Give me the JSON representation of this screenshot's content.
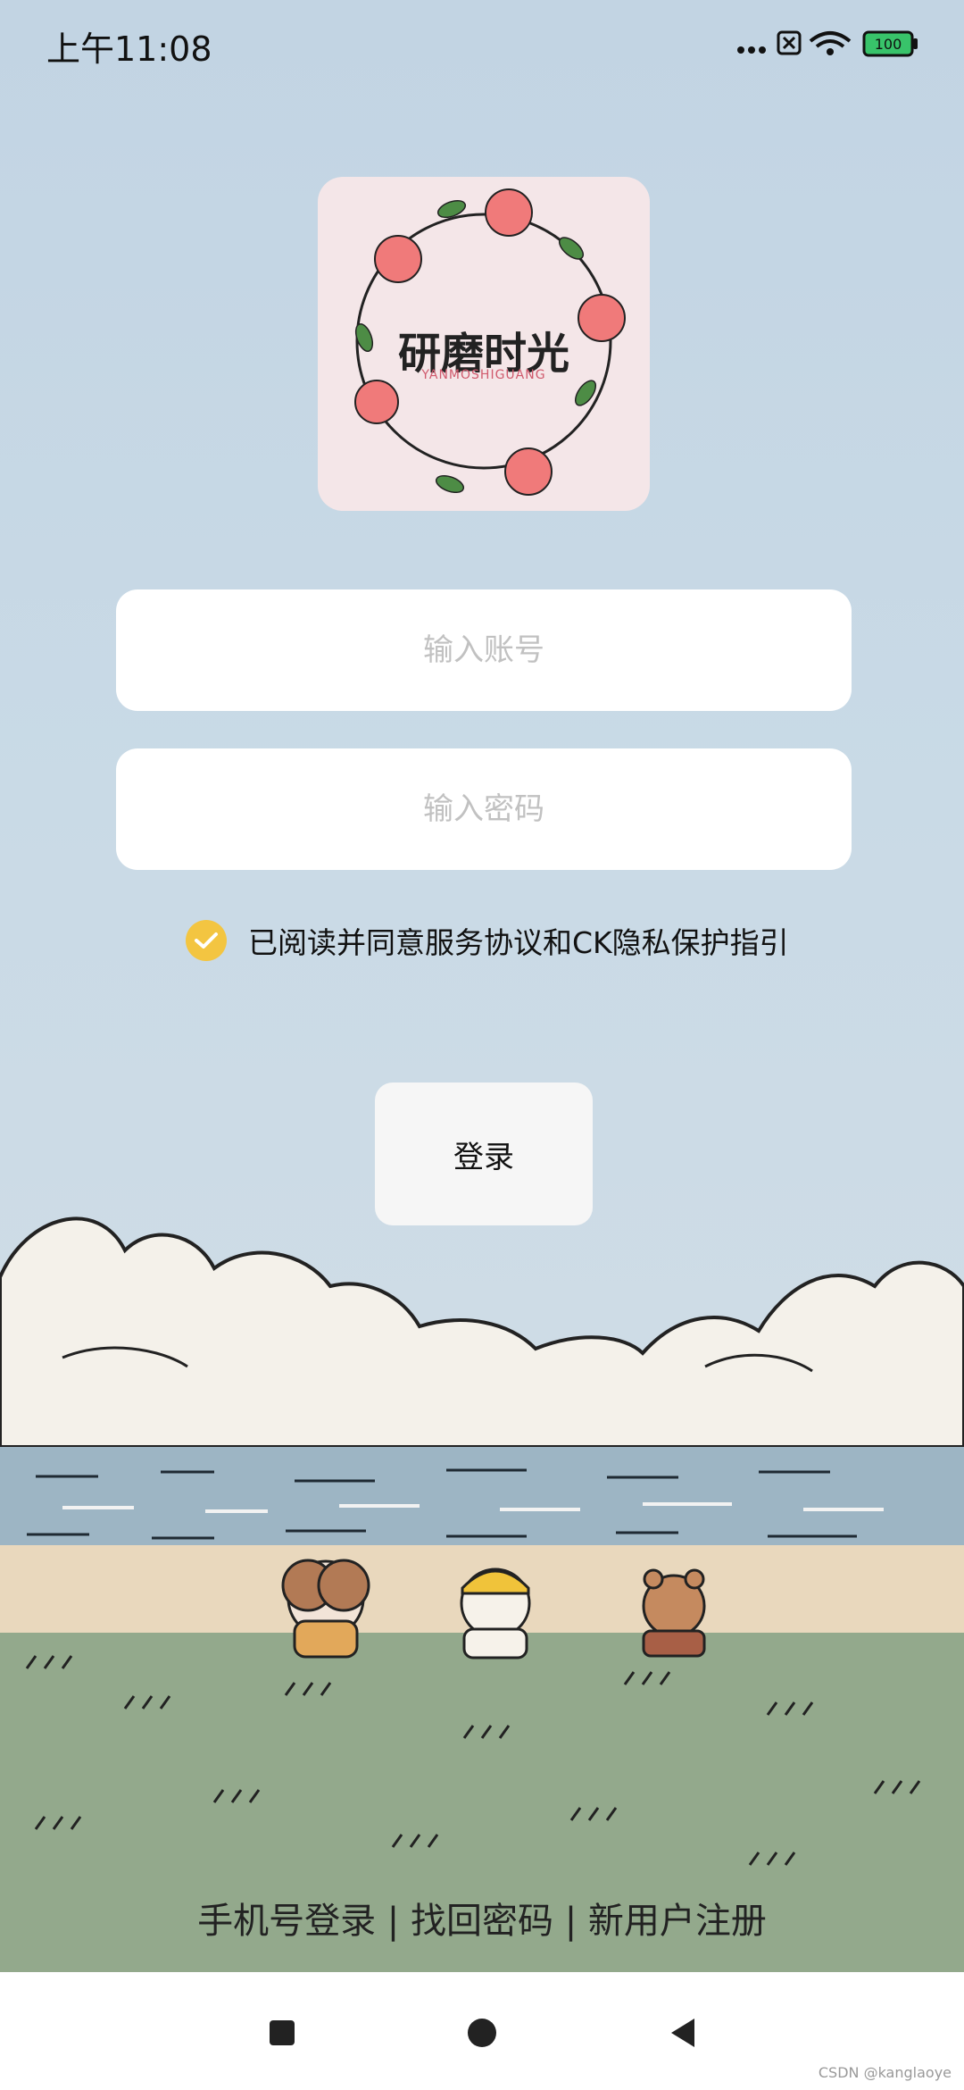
{
  "status_bar": {
    "time": "上午11:08",
    "battery": "100"
  },
  "logo": {
    "title": "研磨时光",
    "subtitle": "YANMOSHIGUANG"
  },
  "form": {
    "account_placeholder": "输入账号",
    "password_placeholder": "输入密码",
    "agreement_text": "已阅读并同意服务协议和CK隐私保护指引",
    "agreement_checked": true,
    "login_button": "登录"
  },
  "links": {
    "phone_login": "手机号登录",
    "separator_1": "|",
    "forgot_password": "找回密码",
    "separator_2": "|",
    "register": "新用户注册"
  },
  "watermark": "CSDN @kanglaoye",
  "colors": {
    "checkbox": "#f3c541",
    "input_bg": "#ffffff",
    "nav_bg": "#ffffff"
  }
}
